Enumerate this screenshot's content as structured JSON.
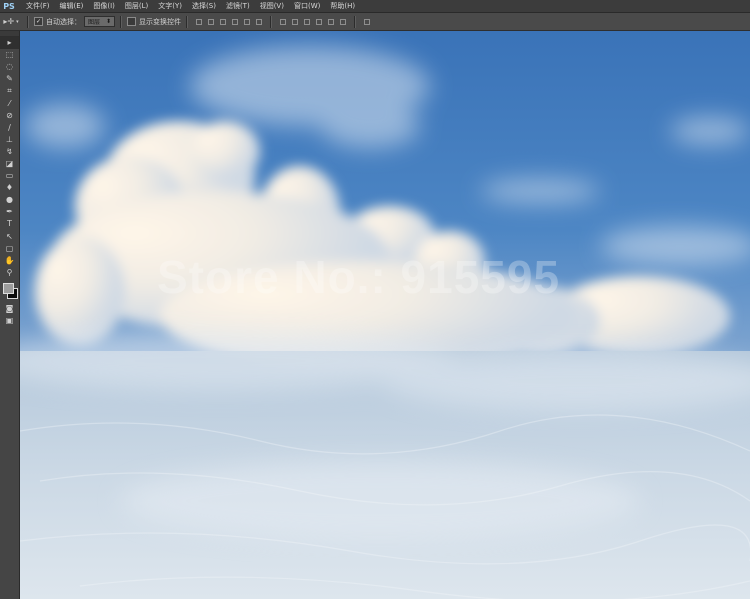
{
  "app": {
    "logo": "PS"
  },
  "menu": [
    {
      "label": "文件(F)"
    },
    {
      "label": "编辑(E)"
    },
    {
      "label": "图像(I)"
    },
    {
      "label": "图层(L)"
    },
    {
      "label": "文字(Y)"
    },
    {
      "label": "选择(S)"
    },
    {
      "label": "滤镜(T)"
    },
    {
      "label": "视图(V)"
    },
    {
      "label": "窗口(W)"
    },
    {
      "label": "帮助(H)"
    }
  ],
  "options": {
    "auto_select_label": "自动选择：",
    "auto_select_checked": true,
    "auto_select_target": "图层",
    "show_transform_label": "显示变换控件",
    "show_transform_checked": false
  },
  "tools": [
    {
      "icon": "move-tool-icon",
      "glyph": "▸"
    },
    {
      "icon": "marquee-tool-icon",
      "glyph": "⬚"
    },
    {
      "icon": "lasso-tool-icon",
      "glyph": "◌"
    },
    {
      "icon": "quick-select-tool-icon",
      "glyph": "✎"
    },
    {
      "icon": "crop-tool-icon",
      "glyph": "⌗"
    },
    {
      "icon": "eyedropper-tool-icon",
      "glyph": "⁄"
    },
    {
      "icon": "healing-brush-tool-icon",
      "glyph": "⊘"
    },
    {
      "icon": "brush-tool-icon",
      "glyph": "∕"
    },
    {
      "icon": "clone-stamp-tool-icon",
      "glyph": "⊥"
    },
    {
      "icon": "history-brush-tool-icon",
      "glyph": "↯"
    },
    {
      "icon": "eraser-tool-icon",
      "glyph": "◪"
    },
    {
      "icon": "gradient-tool-icon",
      "glyph": "▭"
    },
    {
      "icon": "blur-tool-icon",
      "glyph": "♦"
    },
    {
      "icon": "dodge-tool-icon",
      "glyph": "●"
    },
    {
      "icon": "pen-tool-icon",
      "glyph": "✒"
    },
    {
      "icon": "type-tool-icon",
      "glyph": "T"
    },
    {
      "icon": "path-select-tool-icon",
      "glyph": "↖"
    },
    {
      "icon": "shape-tool-icon",
      "glyph": "▢"
    },
    {
      "icon": "hand-tool-icon",
      "glyph": "✋"
    },
    {
      "icon": "zoom-tool-icon",
      "glyph": "⚲"
    }
  ],
  "bottom_tools": [
    {
      "icon": "quick-mask-icon",
      "glyph": "◙"
    },
    {
      "icon": "screen-mode-icon",
      "glyph": "▣"
    }
  ],
  "colors": {
    "foreground": "#9c9c9c",
    "background": "#0c0c0c",
    "sky_top": "#2f6fb7",
    "sky_mid": "#4a87c8",
    "cloud": "#f4f1ea",
    "sea": "#c7d6e4"
  },
  "canvas": {
    "watermark": "Store No.: 915595"
  }
}
